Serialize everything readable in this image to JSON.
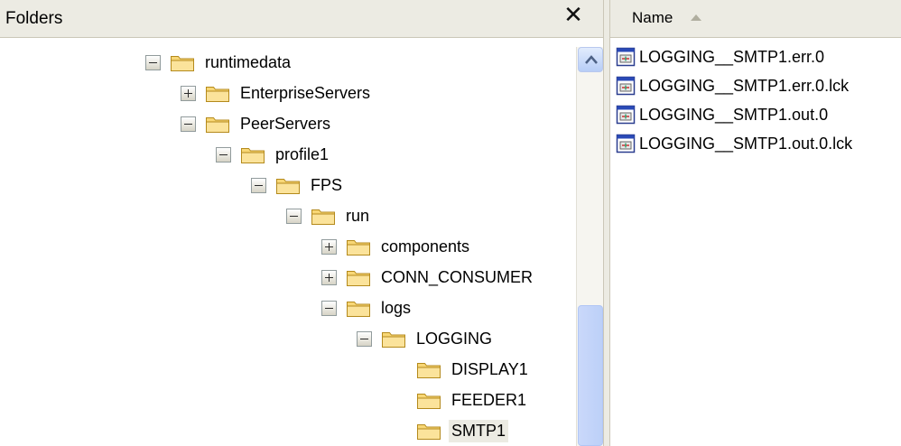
{
  "folders_pane": {
    "title": "Folders",
    "close_glyph": "✕"
  },
  "tree": [
    {
      "label": "runtimedata",
      "expander": "minus",
      "level": 0
    },
    {
      "label": "EnterpriseServers",
      "expander": "plus",
      "level": 1
    },
    {
      "label": "PeerServers",
      "expander": "minus",
      "level": 1
    },
    {
      "label": "profile1",
      "expander": "minus",
      "level": 2
    },
    {
      "label": "FPS",
      "expander": "minus",
      "level": 3
    },
    {
      "label": "run",
      "expander": "minus",
      "level": 4
    },
    {
      "label": "components",
      "expander": "plus",
      "level": 5
    },
    {
      "label": "CONN_CONSUMER",
      "expander": "plus",
      "level": 5
    },
    {
      "label": "logs",
      "expander": "minus",
      "level": 5
    },
    {
      "label": "LOGGING",
      "expander": "minus",
      "level": 6
    },
    {
      "label": "DISPLAY1",
      "expander": "none",
      "level": 7
    },
    {
      "label": "FEEDER1",
      "expander": "none",
      "level": 7
    },
    {
      "label": "SMTP1",
      "expander": "none",
      "level": 7,
      "selected": true
    }
  ],
  "files_pane": {
    "column_header": "Name",
    "sort_icon": "sort-ascending-arrow-icon",
    "files": [
      {
        "name": "LOGGING__SMTP1.err.0",
        "icon": "log-file-icon"
      },
      {
        "name": "LOGGING__SMTP1.err.0.lck",
        "icon": "log-file-icon"
      },
      {
        "name": "LOGGING__SMTP1.out.0",
        "icon": "log-file-icon"
      },
      {
        "name": "LOGGING__SMTP1.out.0.lck",
        "icon": "log-file-icon"
      }
    ]
  },
  "colors": {
    "pane_header": "#ecebe3",
    "folder_fill": "#f8d776",
    "scrollbar_thumb": "#c3d4f9",
    "selection": "#ecebe3"
  }
}
